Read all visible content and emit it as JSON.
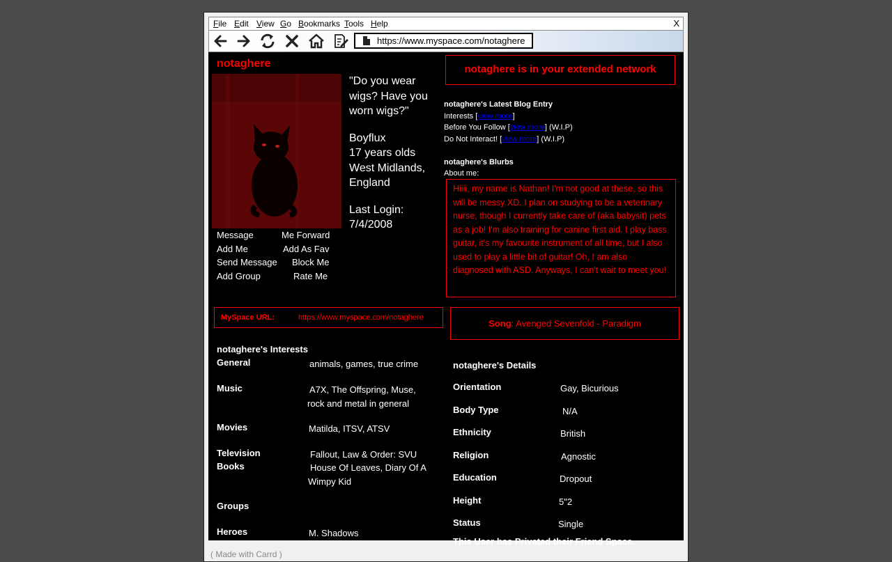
{
  "menu": [
    "File",
    "Edit",
    "View",
    "Go",
    "Bookmarks",
    "Tools",
    "Help"
  ],
  "close_label": "X",
  "address": "https://www.myspace.com/notaghere",
  "profile": {
    "name": "notaghere",
    "quote": "\"Do you wear wigs? Have you worn wigs?\"",
    "info_lines": [
      "Boyflux",
      "17 years olds",
      "West Midlands, England"
    ],
    "last_login_label": "Last Login:",
    "last_login": "7/4/2008"
  },
  "actions": [
    "Message",
    "Me Forward",
    "Add Me",
    "Add As Fav",
    "Send Message",
    "Block Me",
    "Add Group",
    "Rate Me"
  ],
  "network_text": "notaghere is in your extended network",
  "blog": {
    "title": "notaghere's Latest Blog Entry",
    "entries": [
      {
        "name": "Interests",
        "link": "view more",
        "suffix": ""
      },
      {
        "name": "Before You Follow",
        "link": "view more",
        "suffix": "(W.I.P)"
      },
      {
        "name": "Do Not Interact!",
        "link": "view more",
        "suffix": "(W.I.P)"
      }
    ]
  },
  "blurbs": {
    "title": "notaghere's Blurbs",
    "about_label": "About me:",
    "about_text": "Hiiii, my name is Nathan! I'm not good at these, so this will be messy XD. I plan on studying to be a veterinary nurse, though I currently take care of (aka babysit) pets as a job! I'm also training for canine first aid. I play bass guitar, it's my favourite instrument of all time, but I also used to play a little bit of guitar! Oh, I am also diagnosed with ASD. Anyways, I can't wait to meet you!"
  },
  "myspace_url": {
    "label": "MySpace URL:",
    "value": "https://www.myspace.com/notaghere"
  },
  "song": {
    "label": "Song",
    "value": ": Avenged Sevenfold - Paradigm"
  },
  "interests": {
    "title": "notaghere's Interests",
    "rows": [
      {
        "k": "General",
        "v": "animals, games, true crime"
      },
      {
        "k": "Music",
        "v": "A7X, The Offspring, Muse, rock and metal in general"
      },
      {
        "k": "Movies",
        "v": "Matilda, ITSV, ATSV"
      },
      {
        "k": "Television",
        "v": "Fallout, Law & Order: SVU"
      },
      {
        "k": "Books",
        "v": "House Of Leaves, Diary Of A Wimpy Kid"
      },
      {
        "k": "Groups",
        "v": ""
      },
      {
        "k": "Heroes",
        "v": "M. Shadows"
      }
    ]
  },
  "details": {
    "title": "notaghere's Details",
    "rows": [
      {
        "k": "Orientation",
        "v": "Gay, Bicurious"
      },
      {
        "k": "Body Type",
        "v": "N/A"
      },
      {
        "k": "Ethnicity",
        "v": "British"
      },
      {
        "k": "Religion",
        "v": "Agnostic"
      },
      {
        "k": "Education",
        "v": "Dropout"
      },
      {
        "k": "Height",
        "v": "5\"2"
      },
      {
        "k": "Status",
        "v": "Single"
      }
    ],
    "friend_note": "This User has Privated their Friend Space."
  },
  "footer": "( Made with Carrd )",
  "colors": {
    "accent": "#ff0000",
    "background": "#000000",
    "link": "#0000ee"
  }
}
